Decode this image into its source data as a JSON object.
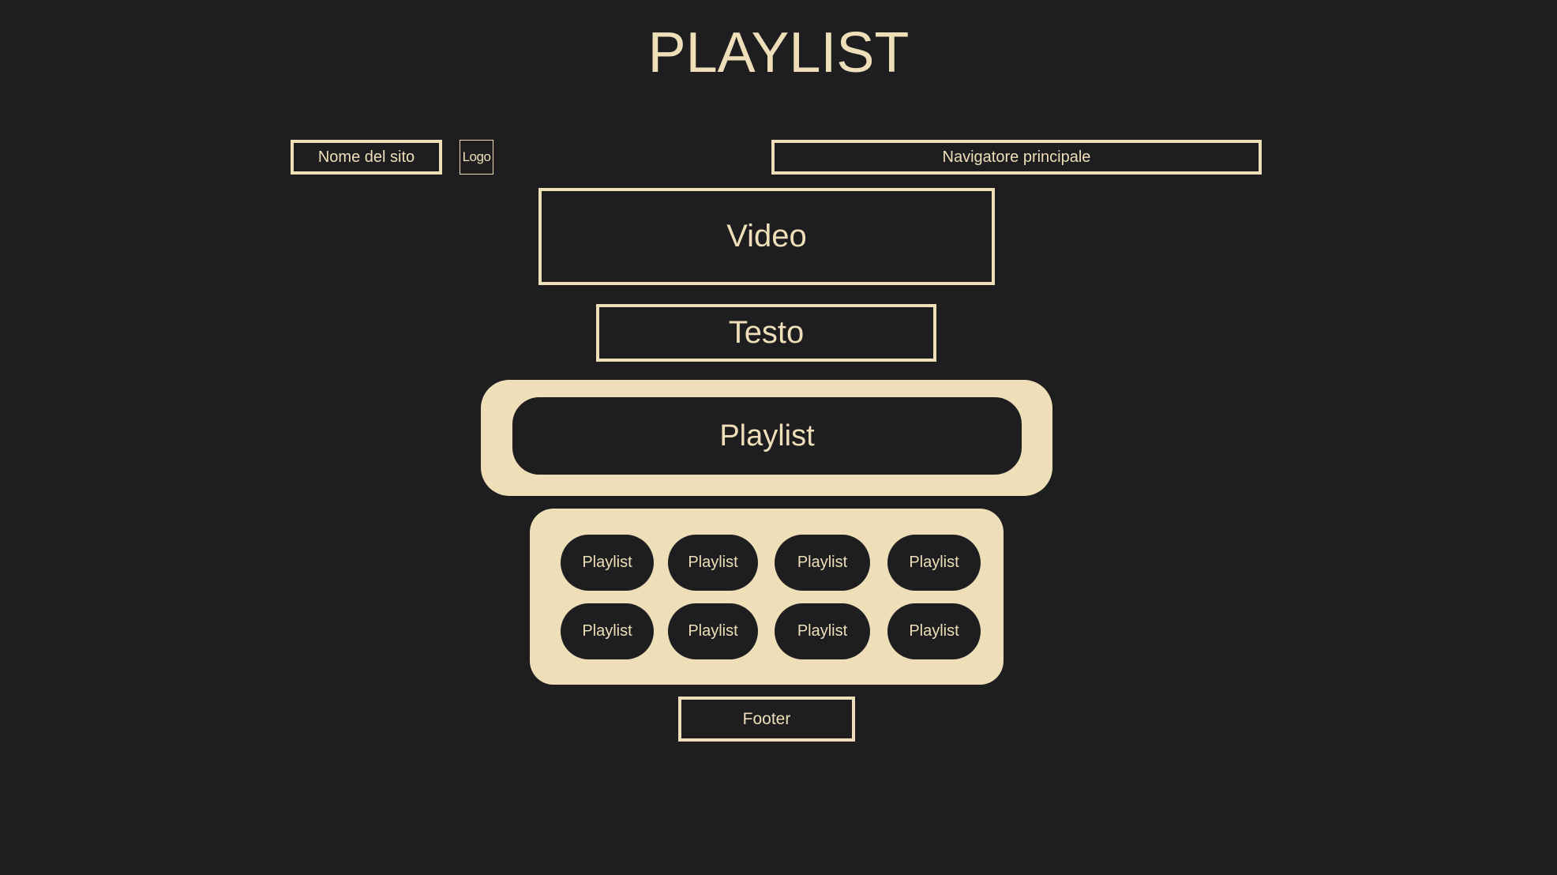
{
  "title": "PLAYLIST",
  "header": {
    "site_name": "Nome del sito",
    "logo": "Logo",
    "nav": "Navigatore principale"
  },
  "main": {
    "video": "Video",
    "text": "Testo",
    "playlist": "Playlist"
  },
  "playlist_grid": {
    "items": [
      "Playlist",
      "Playlist",
      "Playlist",
      "Playlist",
      "Playlist",
      "Playlist",
      "Playlist",
      "Playlist"
    ]
  },
  "footer": "Footer",
  "colors": {
    "background": "#1e1e20",
    "accent": "#efdfb9"
  }
}
